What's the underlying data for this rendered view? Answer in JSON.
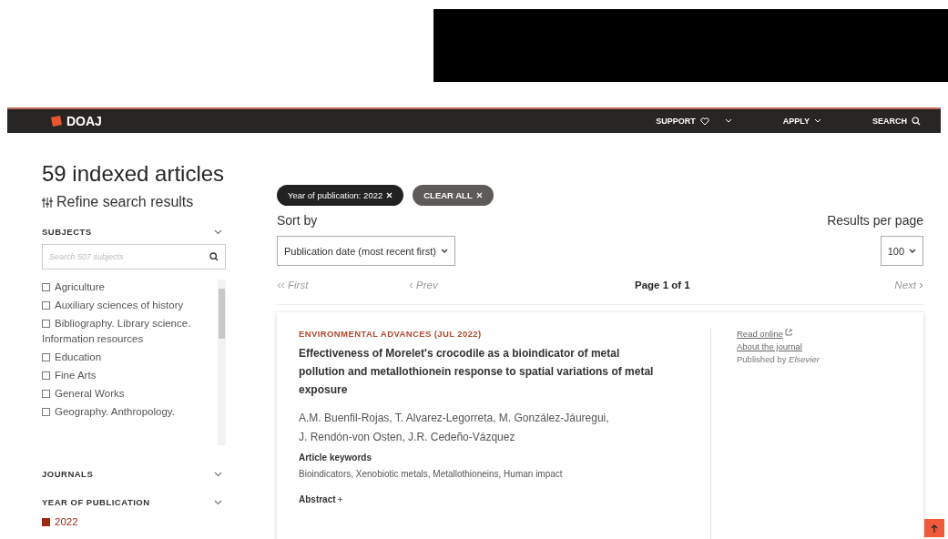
{
  "nav": {
    "logo": "DOAJ",
    "items": [
      {
        "label": "SUPPORT",
        "kind": "heart-dropdown"
      },
      {
        "label": "APPLY",
        "kind": "dropdown"
      },
      {
        "label": "SEARCH",
        "kind": "search"
      }
    ]
  },
  "heading": "59 indexed articles",
  "refine": "Refine search results",
  "filters": [
    {
      "title": "SUBJECTS",
      "search_placeholder": "Search 507 subjects",
      "options": [
        {
          "label": "Agriculture",
          "checked": false
        },
        {
          "label": "Auxiliary sciences of history",
          "checked": false
        },
        {
          "label": "Bibliography. Library science. Information resources",
          "checked": false
        },
        {
          "label": "Education",
          "checked": false
        },
        {
          "label": "Fine Arts",
          "checked": false
        },
        {
          "label": "General Works",
          "checked": false
        },
        {
          "label": "Geography. Anthropology.",
          "checked": false
        }
      ]
    },
    {
      "title": "JOURNALS"
    },
    {
      "title": "YEAR OF PUBLICATION",
      "options": [
        {
          "label": "2022",
          "checked": true
        }
      ]
    }
  ],
  "chips": [
    {
      "label": "Year of publication: 2022",
      "kind": "filter"
    },
    {
      "label": "CLEAR ALL",
      "kind": "clear"
    }
  ],
  "sort_label": "Sort by",
  "sort_value": "Publication date (most recent first)",
  "per_page_label": "Results per page",
  "per_page_value": "100",
  "pager": {
    "first": "First",
    "prev": "Prev",
    "page": "Page 1 of 1",
    "next": "Next"
  },
  "article": {
    "source": "ENVIRONMENTAL ADVANCES (JUL 2022)",
    "title": "Effectiveness of Morelet's crocodile as a bioindicator of metal pollution and metallothionein response to spatial variations of metal exposure",
    "authors": [
      "A.M. Buenfil-Rojas, T. Alvarez-Legorreta, M. González-Jáuregui,",
      "J. Rendón-von Osten, J.R. Cedeño-Vázquez"
    ],
    "keywords_label": "Article keywords",
    "keywords": "Bioindicators, Xenobiotic metals, Metallothioneins, Human impact",
    "abstract_label": "Abstract",
    "links": [
      "Read online",
      "About the journal"
    ],
    "publisher": "Published by *Elsevier*"
  }
}
